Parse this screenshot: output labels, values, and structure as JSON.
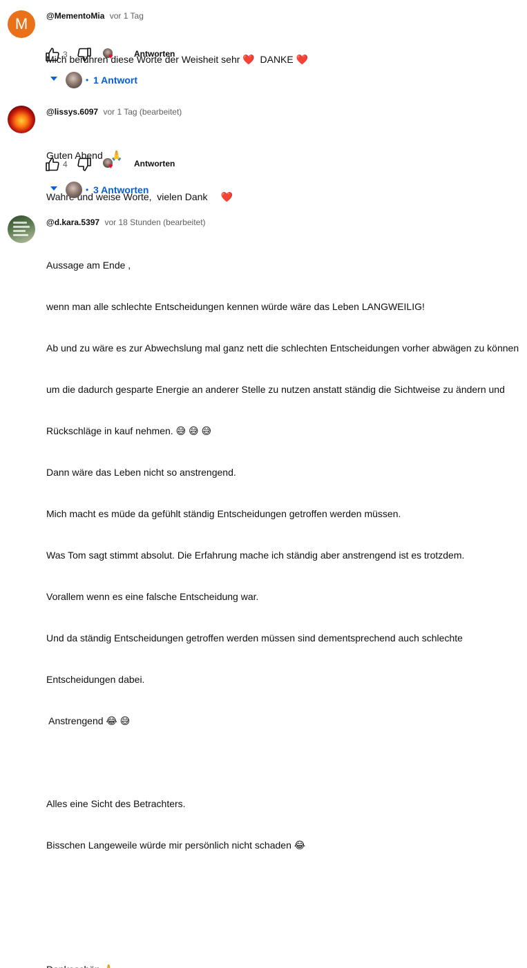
{
  "comments": [
    {
      "avatar_letter": "M",
      "author": "@MementoMia",
      "time": "vor 1 Tag",
      "lines": [
        "Mich berühren diese Worte der Weisheit sehr ❤️  DANKE ❤️"
      ],
      "like_count": "3",
      "reply_label": "Antworten",
      "replies_label": "1 Antwort"
    },
    {
      "author": "@lissys.6097",
      "time": "vor 1 Tag (bearbeitet)",
      "lines": [
        "Guten Abend   🙏",
        "Wahre und weise Worte,  vielen Dank     ❤️"
      ],
      "like_count": "4",
      "reply_label": "Antworten",
      "replies_label": "3 Antworten"
    },
    {
      "author": "@d.kara.5397",
      "time": "vor 18 Stunden (bearbeitet)",
      "lines": [
        "Aussage am Ende ,",
        "wenn man alle schlechte Entscheidungen kennen würde wäre das Leben LANGWEILIG!",
        "Ab und zu wäre es zur Abwechslung mal ganz nett die schlechten Entscheidungen vorher abwägen zu können",
        "um die dadurch gesparte Energie an anderer Stelle zu nutzen anstatt ständig die Sichtweise zu ändern und",
        "Rückschläge in kauf nehmen. 😅 😅 😅",
        "Dann wäre das Leben nicht so anstrengend.",
        "Mich macht es müde da gefühlt ständig Entscheidungen getroffen werden müssen.",
        "Was Tom sagt stimmt absolut. Die Erfahrung mache ich ständig aber anstrengend ist es trotzdem.",
        "Vorallem wenn es eine falsche Entscheidung war.",
        "Und da ständig Entscheidungen getroffen werden müssen sind dementsprechend auch schlechte",
        "Entscheidungen dabei.",
        " Anstrengend 😂 😅",
        "",
        "Alles eine Sicht des Betrachters.",
        "Bisschen Langeweile würde mir persönlich nicht schaden 😂",
        "",
        "",
        "Dankeschön 🙏"
      ]
    }
  ]
}
